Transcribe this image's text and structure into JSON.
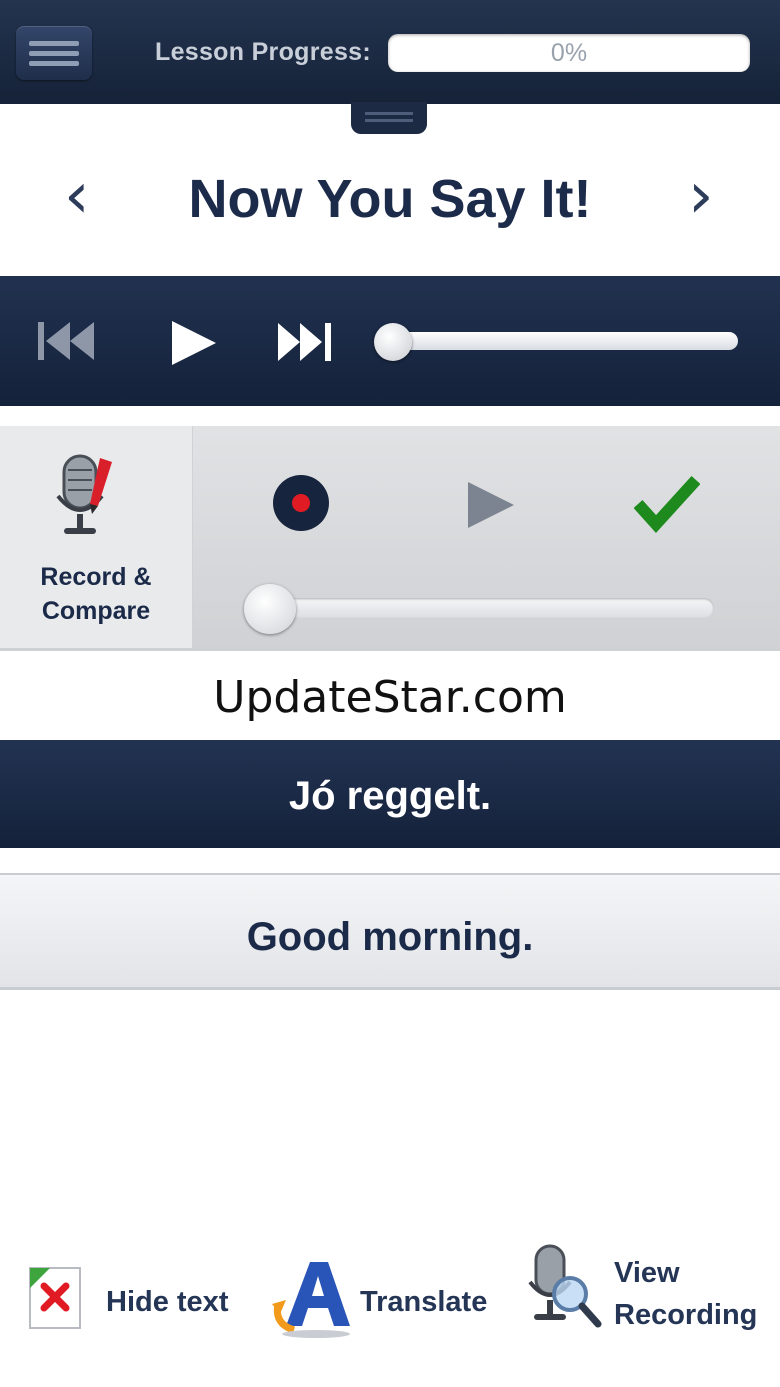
{
  "header": {
    "menu_icon": "hamburger-icon",
    "progress_label": "Lesson Progress:",
    "progress_text": "0%",
    "progress_value": 0
  },
  "title_row": {
    "prev_glyph": "‹",
    "title": "Now You Say It!",
    "next_glyph": "›"
  },
  "player": {
    "rewind_icon": "skip-back-icon",
    "play_icon": "play-icon",
    "forward_icon": "skip-forward-icon",
    "position": 0
  },
  "record": {
    "label_line1": "Record &",
    "label_line2": "Compare",
    "icon": "microphone-icon",
    "record_icon": "record-icon",
    "playback_icon": "play-icon",
    "check_icon": "checkmark-icon",
    "position": 0
  },
  "watermark": "UpdateStar.com",
  "phrases": {
    "target": "Jó reggelt.",
    "translation": "Good morning."
  },
  "toolbar": {
    "hide_text": "Hide text",
    "translate": "Translate",
    "view_recording_line1": "View",
    "view_recording_line2": "Recording"
  },
  "colors": {
    "navy": "#1c2b4a",
    "record_red": "#e01b24",
    "check_green": "#1e8a1e"
  }
}
